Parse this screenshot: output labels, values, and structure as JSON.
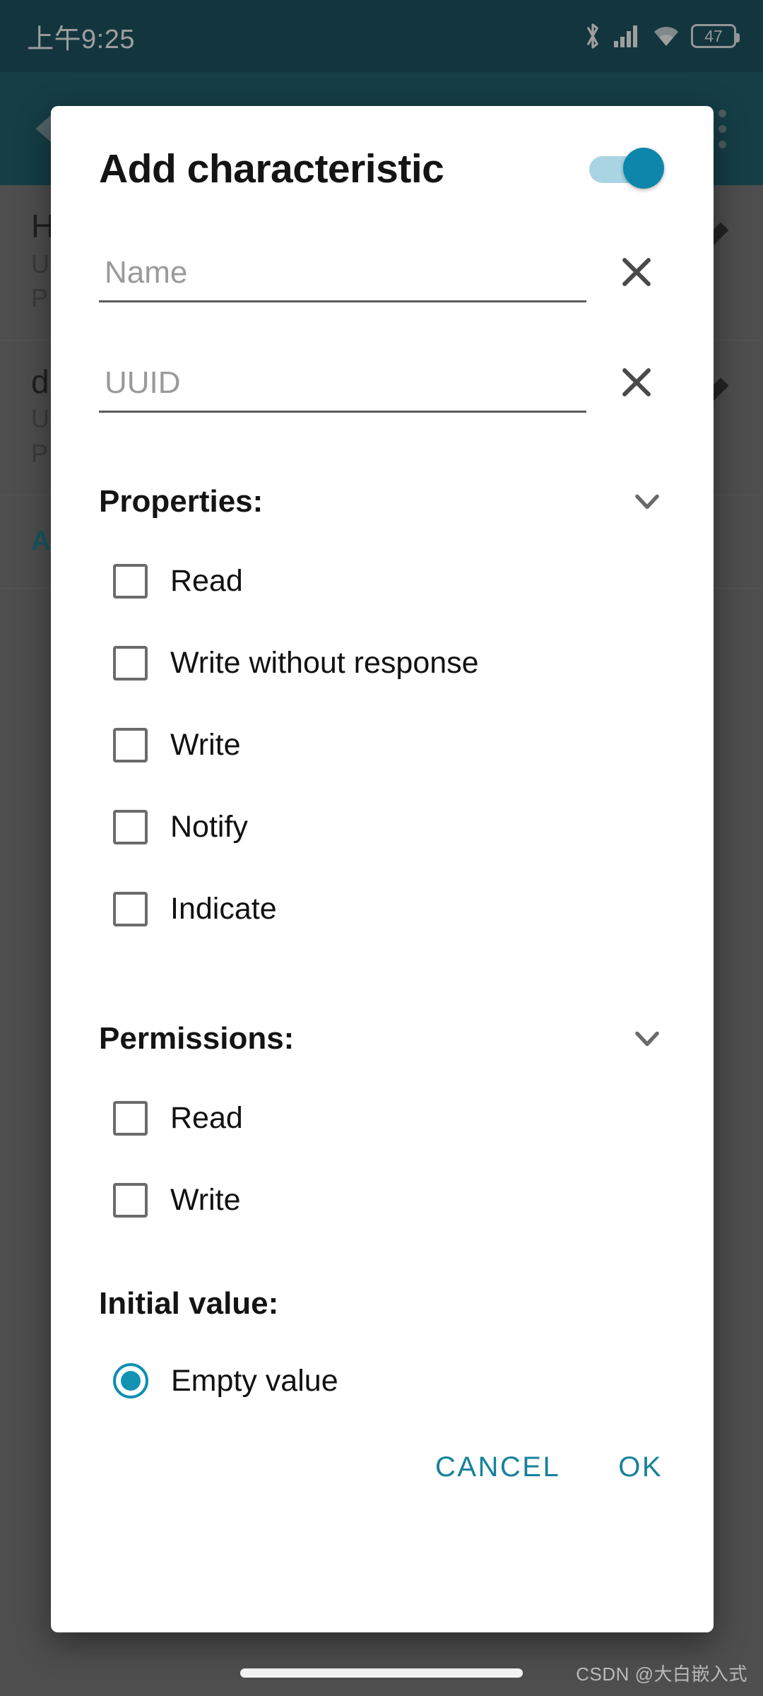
{
  "status_bar": {
    "clock": "上午9:25",
    "icons": [
      "bluetooth-icon",
      "cellular-signal-icon",
      "wifi-icon",
      "battery-icon"
    ],
    "battery_level": "47"
  },
  "app_bar": {
    "back_icon": "back-arrow-icon",
    "overflow_icon": "overflow-menu-icon"
  },
  "background_list": {
    "rows": [
      {
        "title": "H",
        "uuid": "U",
        "properties": "P",
        "edit_icon": "edit-pencil-icon"
      },
      {
        "title": "d",
        "uuid": "U",
        "properties": "P",
        "edit_icon": "edit-pencil-icon"
      }
    ],
    "action_label": "A"
  },
  "dialog": {
    "title": "Add characteristic",
    "enable_toggle": {
      "name": "enable-toggle",
      "state": "on"
    },
    "fields": [
      {
        "name": "name-field",
        "value": "",
        "placeholder": "Name",
        "clear_icon": "clear-x-icon"
      },
      {
        "name": "uuid-field",
        "value": "",
        "placeholder": "UUID",
        "clear_icon": "clear-x-icon"
      }
    ],
    "properties_section": {
      "label": "Properties:",
      "chevron_icon": "chevron-down-icon",
      "items": [
        {
          "label": "Read",
          "checked": false
        },
        {
          "label": "Write without response",
          "checked": false
        },
        {
          "label": "Write",
          "checked": false
        },
        {
          "label": "Notify",
          "checked": false
        },
        {
          "label": "Indicate",
          "checked": false
        }
      ]
    },
    "permissions_section": {
      "label": "Permissions:",
      "chevron_icon": "chevron-down-icon",
      "items": [
        {
          "label": "Read",
          "checked": false
        },
        {
          "label": "Write",
          "checked": false
        }
      ]
    },
    "initial_value_section": {
      "label": "Initial value:",
      "options": [
        {
          "label": "Empty value",
          "selected": true
        }
      ]
    },
    "actions": {
      "cancel_label": "CANCEL",
      "ok_label": "OK"
    }
  },
  "watermark": "CSDN @大白嵌入式",
  "colors": {
    "status_bar_bg": "#024150",
    "app_bar_bg": "#06505f",
    "accent_teal": "#17829a",
    "toggle_thumb": "#0e86ab",
    "toggle_track": "#a9d4e3",
    "radio_accent": "#1293b4",
    "dialog_bg": "#ffffff",
    "scrim": "rgba(40,40,40,0.45)"
  }
}
